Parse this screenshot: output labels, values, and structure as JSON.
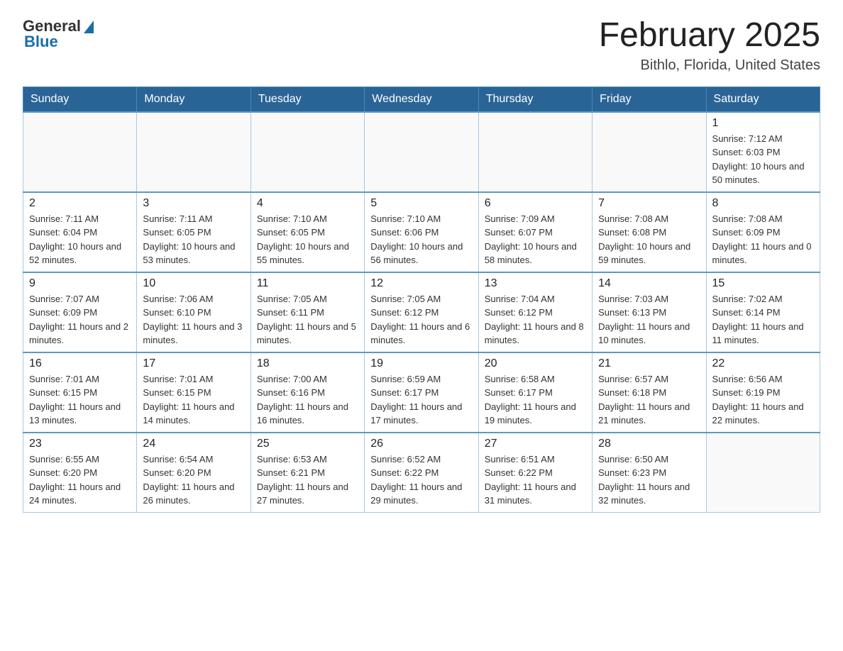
{
  "header": {
    "logo": {
      "general": "General",
      "blue": "Blue"
    },
    "title": "February 2025",
    "location": "Bithlo, Florida, United States"
  },
  "calendar": {
    "days_of_week": [
      "Sunday",
      "Monday",
      "Tuesday",
      "Wednesday",
      "Thursday",
      "Friday",
      "Saturday"
    ],
    "weeks": [
      [
        {
          "day": "",
          "info": ""
        },
        {
          "day": "",
          "info": ""
        },
        {
          "day": "",
          "info": ""
        },
        {
          "day": "",
          "info": ""
        },
        {
          "day": "",
          "info": ""
        },
        {
          "day": "",
          "info": ""
        },
        {
          "day": "1",
          "info": "Sunrise: 7:12 AM\nSunset: 6:03 PM\nDaylight: 10 hours and 50 minutes."
        }
      ],
      [
        {
          "day": "2",
          "info": "Sunrise: 7:11 AM\nSunset: 6:04 PM\nDaylight: 10 hours and 52 minutes."
        },
        {
          "day": "3",
          "info": "Sunrise: 7:11 AM\nSunset: 6:05 PM\nDaylight: 10 hours and 53 minutes."
        },
        {
          "day": "4",
          "info": "Sunrise: 7:10 AM\nSunset: 6:05 PM\nDaylight: 10 hours and 55 minutes."
        },
        {
          "day": "5",
          "info": "Sunrise: 7:10 AM\nSunset: 6:06 PM\nDaylight: 10 hours and 56 minutes."
        },
        {
          "day": "6",
          "info": "Sunrise: 7:09 AM\nSunset: 6:07 PM\nDaylight: 10 hours and 58 minutes."
        },
        {
          "day": "7",
          "info": "Sunrise: 7:08 AM\nSunset: 6:08 PM\nDaylight: 10 hours and 59 minutes."
        },
        {
          "day": "8",
          "info": "Sunrise: 7:08 AM\nSunset: 6:09 PM\nDaylight: 11 hours and 0 minutes."
        }
      ],
      [
        {
          "day": "9",
          "info": "Sunrise: 7:07 AM\nSunset: 6:09 PM\nDaylight: 11 hours and 2 minutes."
        },
        {
          "day": "10",
          "info": "Sunrise: 7:06 AM\nSunset: 6:10 PM\nDaylight: 11 hours and 3 minutes."
        },
        {
          "day": "11",
          "info": "Sunrise: 7:05 AM\nSunset: 6:11 PM\nDaylight: 11 hours and 5 minutes."
        },
        {
          "day": "12",
          "info": "Sunrise: 7:05 AM\nSunset: 6:12 PM\nDaylight: 11 hours and 6 minutes."
        },
        {
          "day": "13",
          "info": "Sunrise: 7:04 AM\nSunset: 6:12 PM\nDaylight: 11 hours and 8 minutes."
        },
        {
          "day": "14",
          "info": "Sunrise: 7:03 AM\nSunset: 6:13 PM\nDaylight: 11 hours and 10 minutes."
        },
        {
          "day": "15",
          "info": "Sunrise: 7:02 AM\nSunset: 6:14 PM\nDaylight: 11 hours and 11 minutes."
        }
      ],
      [
        {
          "day": "16",
          "info": "Sunrise: 7:01 AM\nSunset: 6:15 PM\nDaylight: 11 hours and 13 minutes."
        },
        {
          "day": "17",
          "info": "Sunrise: 7:01 AM\nSunset: 6:15 PM\nDaylight: 11 hours and 14 minutes."
        },
        {
          "day": "18",
          "info": "Sunrise: 7:00 AM\nSunset: 6:16 PM\nDaylight: 11 hours and 16 minutes."
        },
        {
          "day": "19",
          "info": "Sunrise: 6:59 AM\nSunset: 6:17 PM\nDaylight: 11 hours and 17 minutes."
        },
        {
          "day": "20",
          "info": "Sunrise: 6:58 AM\nSunset: 6:17 PM\nDaylight: 11 hours and 19 minutes."
        },
        {
          "day": "21",
          "info": "Sunrise: 6:57 AM\nSunset: 6:18 PM\nDaylight: 11 hours and 21 minutes."
        },
        {
          "day": "22",
          "info": "Sunrise: 6:56 AM\nSunset: 6:19 PM\nDaylight: 11 hours and 22 minutes."
        }
      ],
      [
        {
          "day": "23",
          "info": "Sunrise: 6:55 AM\nSunset: 6:20 PM\nDaylight: 11 hours and 24 minutes."
        },
        {
          "day": "24",
          "info": "Sunrise: 6:54 AM\nSunset: 6:20 PM\nDaylight: 11 hours and 26 minutes."
        },
        {
          "day": "25",
          "info": "Sunrise: 6:53 AM\nSunset: 6:21 PM\nDaylight: 11 hours and 27 minutes."
        },
        {
          "day": "26",
          "info": "Sunrise: 6:52 AM\nSunset: 6:22 PM\nDaylight: 11 hours and 29 minutes."
        },
        {
          "day": "27",
          "info": "Sunrise: 6:51 AM\nSunset: 6:22 PM\nDaylight: 11 hours and 31 minutes."
        },
        {
          "day": "28",
          "info": "Sunrise: 6:50 AM\nSunset: 6:23 PM\nDaylight: 11 hours and 32 minutes."
        },
        {
          "day": "",
          "info": ""
        }
      ]
    ]
  }
}
